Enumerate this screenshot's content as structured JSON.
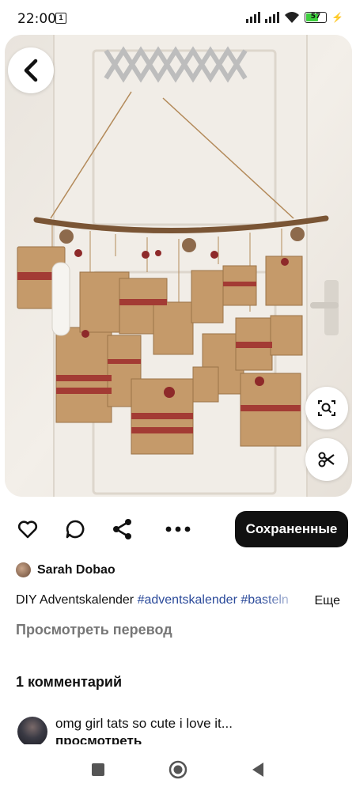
{
  "status_bar": {
    "time": "22:00",
    "notification_badge": "1",
    "battery_percent": "57",
    "battery_level": 0.57
  },
  "pin": {
    "image_icon": "advent-calendar-photo",
    "back_icon": "chevron-left-icon",
    "visual_search_icon": "visual-search-icon",
    "crop_icon": "scissors-icon"
  },
  "actions": {
    "like_icon": "heart-icon",
    "comment_icon": "chat-bubble-icon",
    "share_icon": "share-icon",
    "more_icon": "more-horizontal-icon",
    "save_label": "Сохраненные"
  },
  "author": {
    "name": "Sarah Dobao"
  },
  "description": {
    "text": "DIY Adventskalender ",
    "tags": "#adventskalender #basteln",
    "more_label": "Еще"
  },
  "translate_label": "Просмотреть перевод",
  "comments": {
    "title": "1 комментарий",
    "items": [
      {
        "text": "omg girl tats so cute i love it...",
        "more": "просмотреть"
      }
    ]
  },
  "colors": {
    "save_button_bg": "#111111",
    "hashtag": "#2b4a9a",
    "muted_text": "#767676"
  }
}
